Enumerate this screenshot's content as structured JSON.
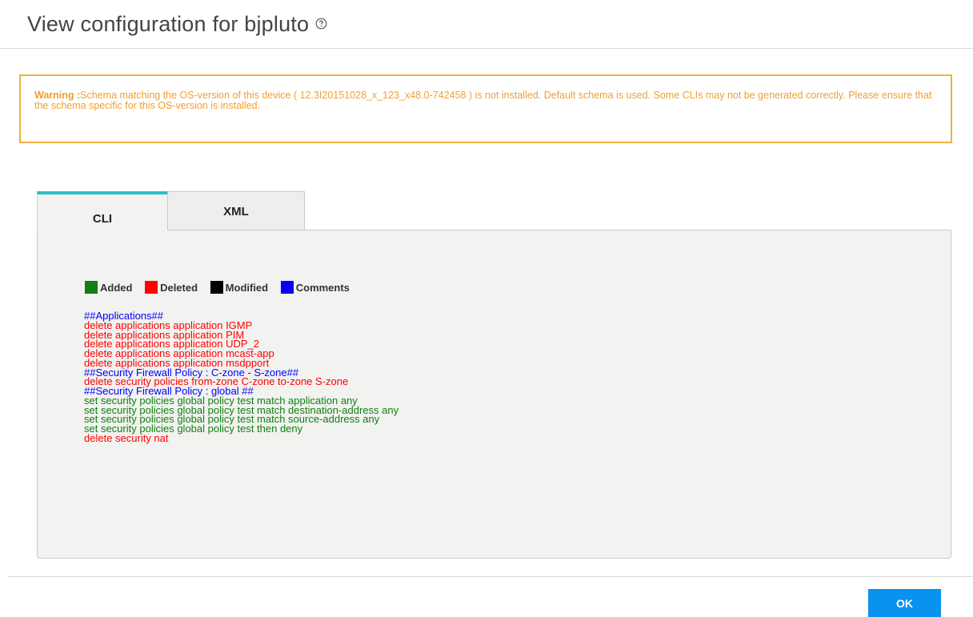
{
  "dialog": {
    "title": "View configuration for bjpluto",
    "help_icon": "help-circle-icon"
  },
  "warning": {
    "label": "Warning :",
    "text": "Schema matching the OS-version of this device ( 12.3I20151028_x_123_x48.0-742458 ) is not installed. Default schema is used. Some CLIs may not be generated correctly. Please ensure that the schema specific for this OS-version is installed.",
    "color": "#f0a030"
  },
  "tabs": [
    {
      "label": "CLI",
      "active": true
    },
    {
      "label": "XML",
      "active": false
    }
  ],
  "legend": [
    {
      "label": "Added",
      "color": "#108010"
    },
    {
      "label": "Deleted",
      "color": "#ff0000"
    },
    {
      "label": "Modified",
      "color": "#000000"
    },
    {
      "label": "Comments",
      "color": "#0000ff"
    }
  ],
  "config_lines": [
    {
      "text": "##Applications##",
      "type": "comment"
    },
    {
      "text": "delete applications application IGMP",
      "type": "deleted"
    },
    {
      "text": "delete applications application PIM",
      "type": "deleted"
    },
    {
      "text": "delete applications application UDP_2",
      "type": "deleted"
    },
    {
      "text": "delete applications application mcast-app",
      "type": "deleted"
    },
    {
      "text": "delete applications application msdpport",
      "type": "deleted"
    },
    {
      "text": "##Security Firewall Policy : C-zone - S-zone##",
      "type": "comment"
    },
    {
      "text": "delete security policies from-zone C-zone to-zone S-zone",
      "type": "deleted"
    },
    {
      "text": "##Security Firewall Policy : global ##",
      "type": "comment"
    },
    {
      "text": "set security policies global policy test match application any",
      "type": "added"
    },
    {
      "text": "set security policies global policy test match destination-address any",
      "type": "added"
    },
    {
      "text": "set security policies global policy test match source-address any",
      "type": "added"
    },
    {
      "text": "set security policies global policy test then deny",
      "type": "added"
    },
    {
      "text": "delete security nat",
      "type": "deleted"
    }
  ],
  "line_colors": {
    "added": "#108010",
    "deleted": "#ff0000",
    "modified": "#000000",
    "comment": "#0000ff"
  },
  "footer": {
    "ok_label": "OK",
    "ok_color": "#0a93ee"
  }
}
